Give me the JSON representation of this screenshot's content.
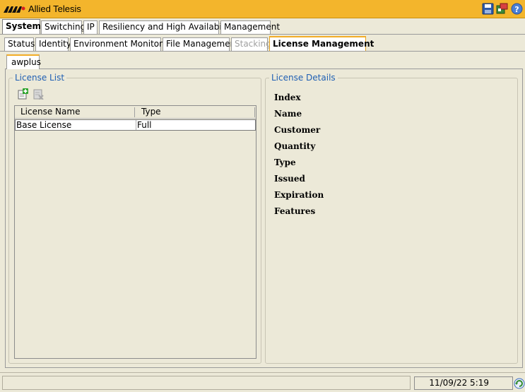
{
  "window": {
    "title": "Allied Telesis"
  },
  "main_tabs": [
    {
      "label": "System",
      "active": true
    },
    {
      "label": "Switching"
    },
    {
      "label": "IP"
    },
    {
      "label": "Resiliency and High Availability"
    },
    {
      "label": "Management"
    }
  ],
  "sub_tabs": [
    {
      "label": "Status"
    },
    {
      "label": "Identity"
    },
    {
      "label": "Environment Monitoring"
    },
    {
      "label": "File Management"
    },
    {
      "label": "Stacking",
      "disabled": true
    },
    {
      "label": "License Management",
      "active": true
    }
  ],
  "device_tab": {
    "label": "awplus"
  },
  "license_list": {
    "legend": "License List",
    "columns": [
      "License Name",
      "Type"
    ],
    "rows": [
      {
        "name": "Base License",
        "type": "Full"
      }
    ]
  },
  "license_details": {
    "legend": "License Details",
    "labels": [
      "Index",
      "Name",
      "Customer",
      "Quantity",
      "Type",
      "Issued",
      "Expiration",
      "Features"
    ]
  },
  "statusbar": {
    "datetime": "11/09/22 5:19"
  },
  "colors": {
    "titlebar": "#f3b52c",
    "legend": "#1f5fb3",
    "tab_highlight": "#f2ac27"
  }
}
